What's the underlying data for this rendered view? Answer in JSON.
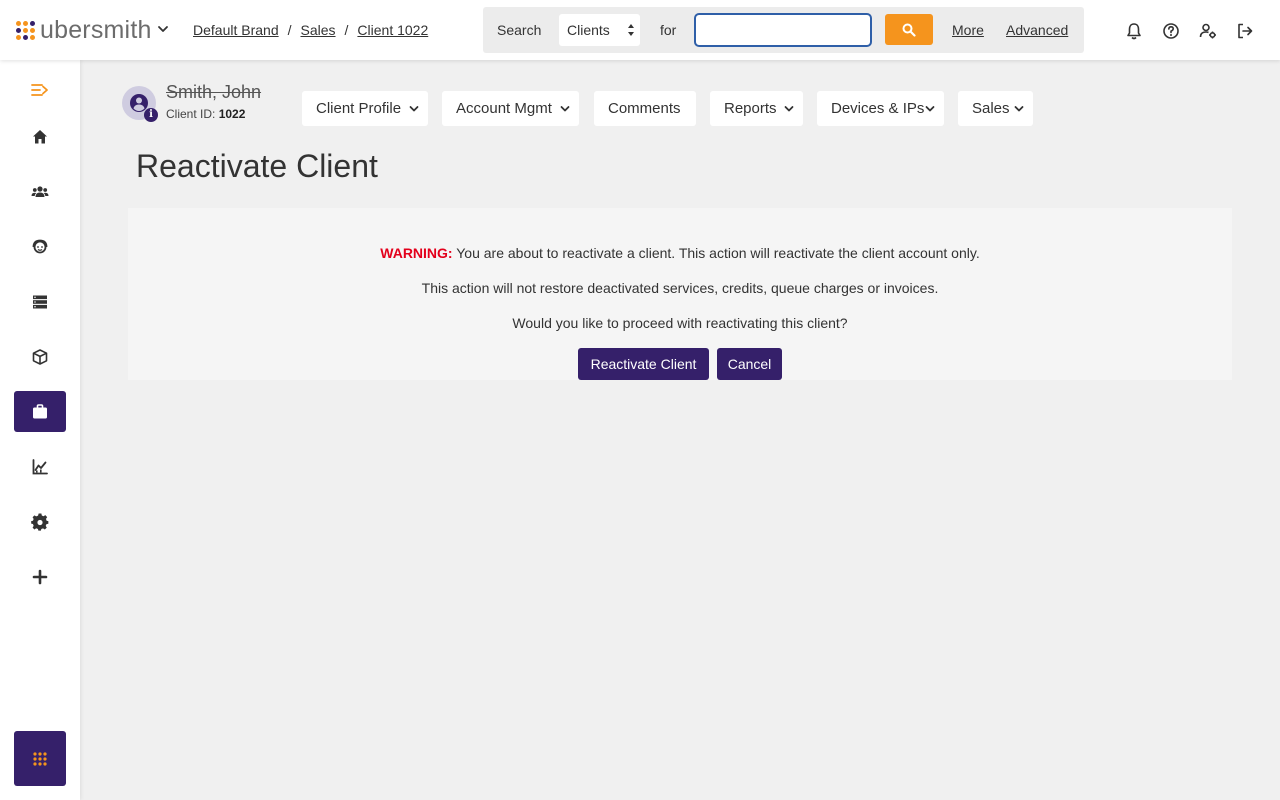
{
  "app": {
    "logo_text": "ubersmith",
    "logo_dot_colors": [
      "#f5941d",
      "#f5941d",
      "#35206a",
      "#35206a",
      "#f5941d",
      "#f5941d",
      "#f5941d",
      "#35206a",
      "#f5941d"
    ]
  },
  "breadcrumb": {
    "items": [
      "Default Brand",
      "Sales",
      "Client 1022"
    ],
    "separator": "/"
  },
  "search": {
    "label": "Search",
    "scope_value": "Clients",
    "for_label": "for",
    "input_value": "",
    "more_label": "More",
    "advanced_label": "Advanced"
  },
  "topbar_icons": [
    "bell-icon",
    "help-icon",
    "user-settings-icon",
    "logout-icon"
  ],
  "sidebar": {
    "items": [
      "menu-toggle-icon",
      "home-icon",
      "clients-icon",
      "support-icon",
      "devices-icon",
      "packages-icon",
      "sales-icon",
      "reports-icon",
      "settings-icon",
      "add-icon"
    ],
    "active": "sales-icon",
    "bottom_icon": "apps-grid-icon"
  },
  "client": {
    "name": "Smith, John",
    "id_label": "Client ID:",
    "id_value": "1022"
  },
  "nav_tabs": [
    {
      "label": "Client Profile",
      "has_dropdown": true
    },
    {
      "label": "Account Mgmt",
      "has_dropdown": true
    },
    {
      "label": "Comments",
      "has_dropdown": false
    },
    {
      "label": "Reports",
      "has_dropdown": true
    },
    {
      "label": "Devices & IPs",
      "has_dropdown": true
    },
    {
      "label": "Sales",
      "has_dropdown": true
    }
  ],
  "page": {
    "title": "Reactivate Client"
  },
  "warning": {
    "label": "WARNING:",
    "line1": "You are about to reactivate a client. This action will reactivate the client account only.",
    "line2": "This action will not restore deactivated services, credits, queue charges or invoices.",
    "line3": "Would you like to proceed with reactivating this client?",
    "confirm_label": "Reactivate Client",
    "cancel_label": "Cancel"
  },
  "colors": {
    "brand_purple": "#35206a",
    "accent_orange": "#f5941d",
    "warning_red": "#e3001b"
  }
}
